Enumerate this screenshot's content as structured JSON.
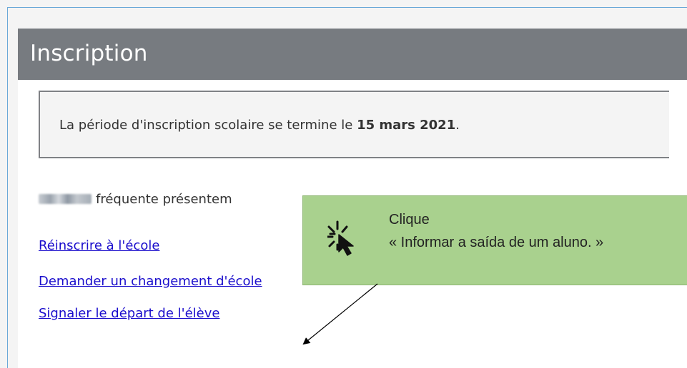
{
  "header": {
    "title": "Inscription"
  },
  "notice": {
    "text_before": "La période d'inscription scolaire se termine le ",
    "date_bold": "15 mars 2021",
    "text_after": "."
  },
  "student": {
    "status_text": "fréquente présentem"
  },
  "links": {
    "reenroll": "Réinscrire à l'école",
    "change_school": "Demander un changement d'école",
    "report_departure": "Signaler le départ de l'élève"
  },
  "callout": {
    "line1": "Clique",
    "line2": "« Informar a saída de um aluno. »",
    "icon": "click-cursor-icon",
    "background_color": "#a9d18e"
  },
  "colors": {
    "header_bg": "#777b80",
    "link": "#1a0dcc",
    "frame_border": "#6aa9d8"
  }
}
